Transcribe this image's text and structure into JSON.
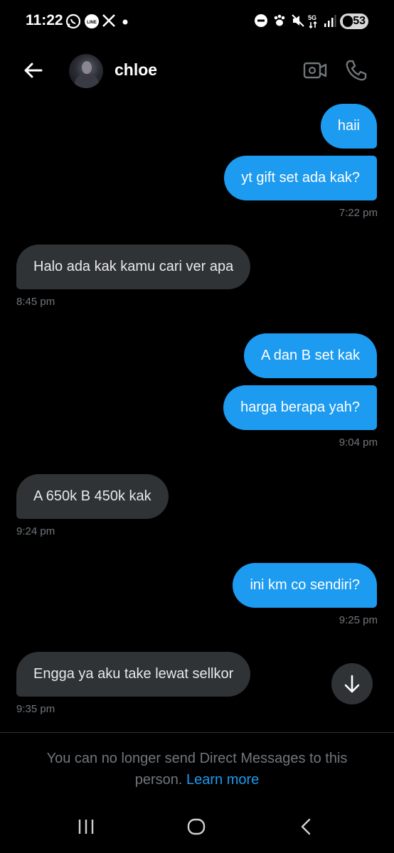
{
  "status_bar": {
    "time": "11:22",
    "battery": "53",
    "network": "5G"
  },
  "header": {
    "contact_name": "chloe"
  },
  "messages": [
    {
      "direction": "sent",
      "text": "haii"
    },
    {
      "direction": "sent",
      "text": "yt gift set ada kak?",
      "time": "7:22 pm"
    },
    {
      "direction": "received",
      "text": "Halo ada kak kamu cari ver apa",
      "time": "8:45 pm"
    },
    {
      "direction": "sent",
      "text": "A dan B set kak"
    },
    {
      "direction": "sent",
      "text": "harga berapa yah?",
      "time": "9:04 pm"
    },
    {
      "direction": "received",
      "text": "A 650k B 450k kak",
      "time": "9:24 pm"
    },
    {
      "direction": "sent",
      "text": "ini km co sendiri?",
      "time": "9:25 pm"
    },
    {
      "direction": "received",
      "text": "Engga ya aku take lewat sellkor",
      "time": "9:35 pm"
    }
  ],
  "footer": {
    "notice_text": "You can no longer send Direct Messages to this person.",
    "learn_more_label": "Learn more"
  },
  "colors": {
    "background": "#000000",
    "sent_bubble": "#1d9bf0",
    "received_bubble": "#2f3336",
    "timestamp": "#71767b",
    "link": "#1d9bf0"
  },
  "icons": {
    "status": [
      "whatsapp-icon",
      "line-icon",
      "x-icon",
      "dnd-icon",
      "paw-icon",
      "mute-icon",
      "signal-icon",
      "battery-icon"
    ],
    "header": [
      "back-arrow-icon",
      "video-call-icon",
      "phone-icon"
    ],
    "nav": [
      "recent-apps-icon",
      "home-icon",
      "back-icon"
    ],
    "scroll": "arrow-down-icon"
  }
}
